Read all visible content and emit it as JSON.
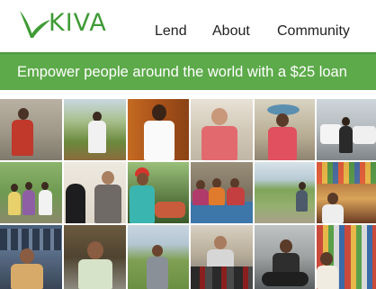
{
  "brand": {
    "name": "KIVA",
    "color": "#3f9b35"
  },
  "nav": {
    "items": [
      {
        "label": "Lend"
      },
      {
        "label": "About"
      },
      {
        "label": "Community"
      }
    ]
  },
  "banner": {
    "text": "Empower people around the world with a $25 loan",
    "color": "#5daa4a"
  },
  "photo_grid": {
    "rows": 3,
    "columns": 6,
    "tiles": [
      {
        "subject": "woman in red dress by stone wall"
      },
      {
        "subject": "man standing in green field"
      },
      {
        "subject": "woman in white shirt by wooden wall"
      },
      {
        "subject": "man in pink shirt in shop"
      },
      {
        "subject": "woman carrying basin on head"
      },
      {
        "subject": "man standing by parked cars"
      },
      {
        "subject": "group of women and children outdoors"
      },
      {
        "subject": "man and woman in hijab"
      },
      {
        "subject": "woman in red headscarf with produce"
      },
      {
        "subject": "group of women seated on blue mat"
      },
      {
        "subject": "man by green field and fence"
      },
      {
        "subject": "woman at market stall"
      },
      {
        "subject": "woman behind shoe stand"
      },
      {
        "subject": "man sitting in front of house"
      },
      {
        "subject": "man standing in grass field"
      },
      {
        "subject": "man with motorcycles"
      },
      {
        "subject": "man on motorcycle"
      },
      {
        "subject": "woman at goods shop"
      }
    ]
  }
}
